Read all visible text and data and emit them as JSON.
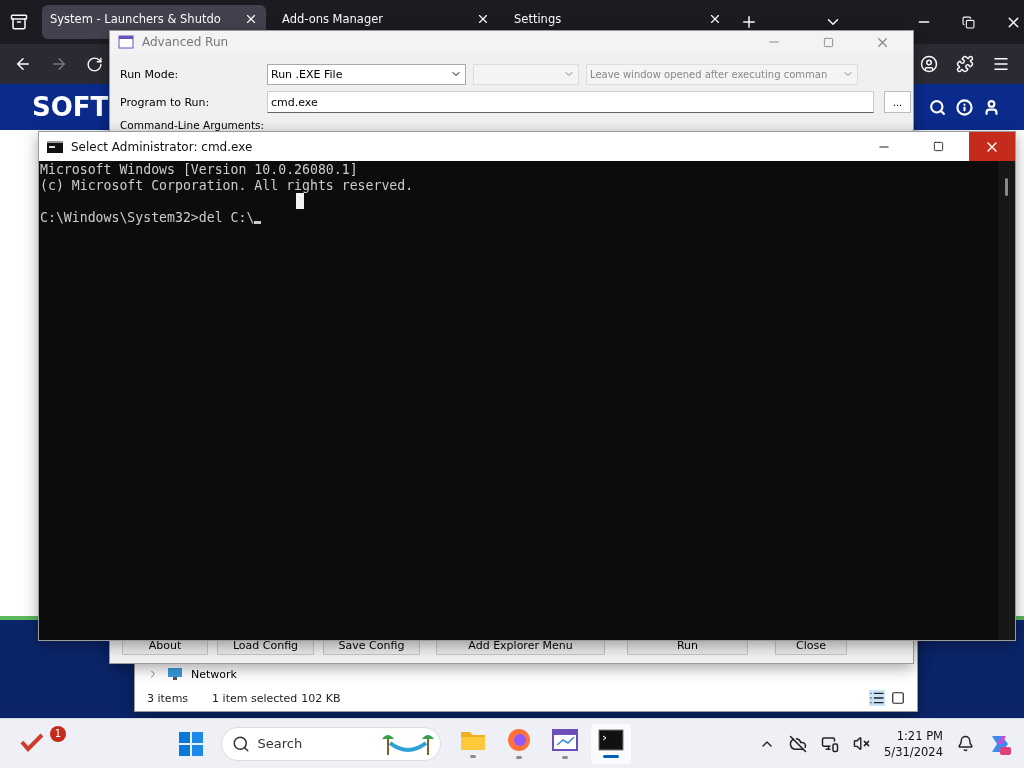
{
  "browser": {
    "tabs": [
      {
        "title": "System - Launchers & Shutdo",
        "selected": true
      },
      {
        "title": "Add-ons Manager",
        "selected": false
      },
      {
        "title": "Settings",
        "selected": false
      }
    ],
    "site_logo": "SOFT"
  },
  "advanced_run": {
    "title": "Advanced Run",
    "run_mode_label": "Run Mode:",
    "run_mode": "Run .EXE File",
    "leave_window_option": {
      "text": "Leave window opened after executing comman",
      "disabled": true
    },
    "program_label": "Program to Run:",
    "program": "cmd.exe",
    "browse_button": "...",
    "args_label": "Command-Line Arguments:",
    "buttons": [
      "About",
      "Load Config",
      "Save Config",
      "Add Explorer Menu",
      "Run",
      "Close"
    ]
  },
  "console": {
    "title": "Select Administrator: cmd.exe",
    "lines": [
      "Microsoft Windows [Version 10.0.26080.1]",
      "(c) Microsoft Corporation. All rights reserved."
    ],
    "prompt": "C:\\Windows\\System32>del C:\\"
  },
  "explorer": {
    "tree_item": "Network",
    "status_count": "3 items",
    "status_selection": "1 item selected",
    "status_size": "102 KB"
  },
  "taskbar": {
    "badge": "1",
    "search_placeholder": "Search",
    "apps": [
      {
        "kind": "folder",
        "selected": false
      },
      {
        "kind": "firefox",
        "selected": false
      },
      {
        "kind": "advancedrun",
        "selected": false
      },
      {
        "kind": "terminal",
        "selected": true
      }
    ],
    "time": "1:21 PM",
    "date": "5/31/2024"
  }
}
